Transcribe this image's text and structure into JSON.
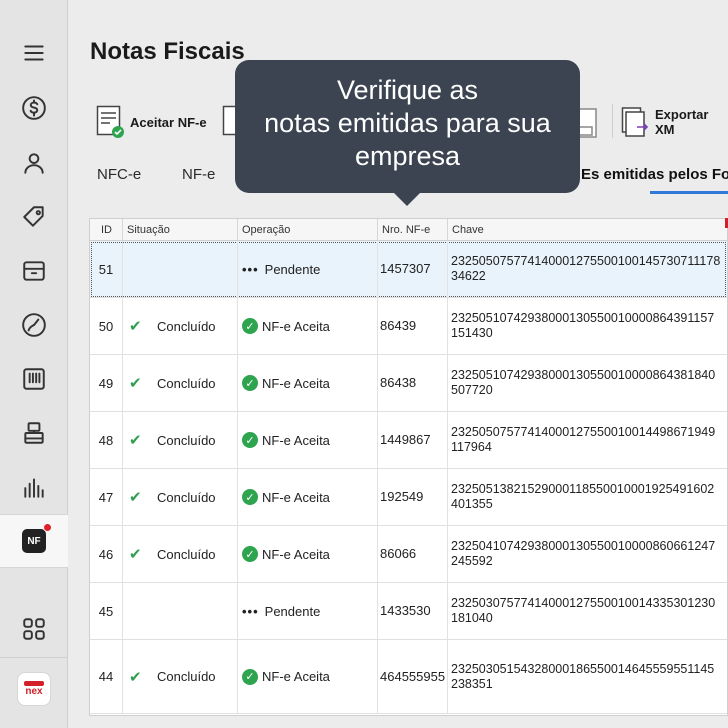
{
  "page": {
    "title": "Notas Fiscais"
  },
  "toolbar": {
    "accept_label": "Aceitar NF-e",
    "export_label": "Exportar XM"
  },
  "tabs": [
    {
      "label": "NFC-e"
    },
    {
      "label": "NF-e"
    },
    {
      "label": "Es emitidas pelos Fo"
    }
  ],
  "tooltip": {
    "line1": "Verifique as",
    "line2": "notas emitidas para sua",
    "line3": "empresa"
  },
  "table": {
    "headers": [
      "ID",
      "Situação",
      "Operação",
      "Nro. NF-e",
      "Chave"
    ],
    "rows": [
      {
        "id": "51",
        "situacao": "",
        "operacao": "Pendente",
        "nro": "1457307",
        "chave": "23250507577414000127550010014573071117834622"
      },
      {
        "id": "50",
        "situacao": "Concluído",
        "operacao": "NF-e Aceita",
        "nro": "86439",
        "chave": "23250510742938000130550010000864391157151430"
      },
      {
        "id": "49",
        "situacao": "Concluído",
        "operacao": "NF-e Aceita",
        "nro": "86438",
        "chave": "23250510742938000130550010000864381840507720"
      },
      {
        "id": "48",
        "situacao": "Concluído",
        "operacao": "NF-e Aceita",
        "nro": "1449867",
        "chave": "23250507577414000127550010014498671949117964"
      },
      {
        "id": "47",
        "situacao": "Concluído",
        "operacao": "NF-e Aceita",
        "nro": "192549",
        "chave": "23250513821529000118550010001925491602401355"
      },
      {
        "id": "46",
        "situacao": "Concluído",
        "operacao": "NF-e Aceita",
        "nro": "86066",
        "chave": "23250410742938000130550010000860661247245592"
      },
      {
        "id": "45",
        "situacao": "",
        "operacao": "Pendente",
        "nro": "1433530",
        "chave": "23250307577414000127550010014335301230181040"
      },
      {
        "id": "44",
        "situacao": "Concluído",
        "operacao": "NF-e Aceita",
        "nro": "464555955",
        "chave": "23250305154328000186550014645559551145238351"
      }
    ]
  },
  "sidebar": {
    "nf_badge": "NF",
    "nex_logo": "nex"
  },
  "colors": {
    "accent": "#2f7ad8",
    "success": "#2ea44f",
    "tooltip_bg": "#3b4450",
    "brand_red": "#d3202a"
  }
}
